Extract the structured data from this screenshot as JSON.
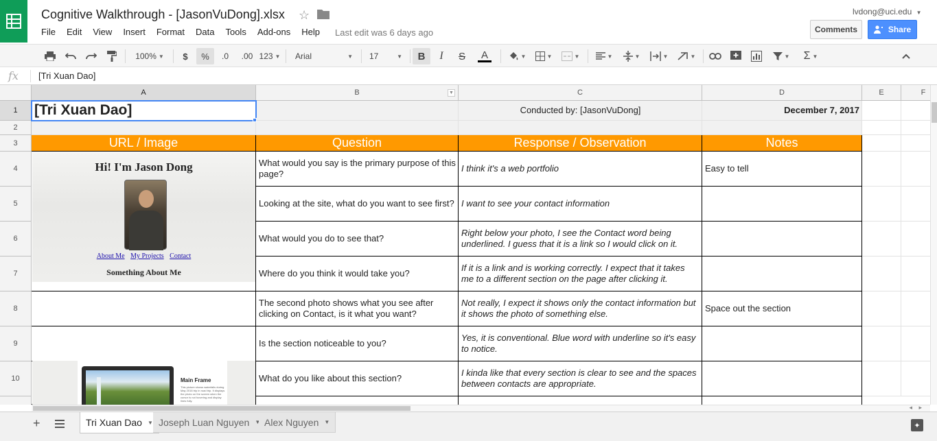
{
  "header": {
    "title": "Cognitive Walkthrough - [JasonVuDong].xlsx",
    "user_email": "lvdong@uci.edu",
    "last_edit": "Last edit was 6 days ago",
    "comments_label": "Comments",
    "share_label": "Share",
    "menu": [
      "File",
      "Edit",
      "View",
      "Insert",
      "Format",
      "Data",
      "Tools",
      "Add-ons",
      "Help"
    ]
  },
  "toolbar": {
    "zoom": "100%",
    "currency": "$",
    "percent": "%",
    "dec_less": ".0",
    "dec_more": ".00",
    "more_formats": "123",
    "font": "Arial",
    "font_size": "17",
    "bold": "B",
    "italic": "I",
    "strike": "S",
    "text_color": "A"
  },
  "formula": {
    "fx": "fx",
    "value": "[Tri Xuan Dao]"
  },
  "columns": [
    "A",
    "B",
    "C",
    "D",
    "E",
    "F"
  ],
  "rows": [
    "1",
    "2",
    "3",
    "4",
    "5",
    "6",
    "7",
    "8",
    "9",
    "10"
  ],
  "sheet": {
    "title_cell": "[Tri Xuan Dao]",
    "conducted_by": "Conducted by: [JasonVuDong]",
    "date": "December 7, 2017",
    "headers": [
      "URL / Image",
      "Question",
      "Response / Observation",
      "Notes"
    ],
    "rows": [
      {
        "q": "What would you say is the primary purpose of this page?",
        "r": "I think it's a web portfolio",
        "n": "Easy to tell"
      },
      {
        "q": "Looking at the site, what do you want to see first?",
        "r": "I want to see your contact information",
        "n": ""
      },
      {
        "q": "What would you do to see that?",
        "r": "Right below your photo, I see the Contact word being underlined. I guess that it is a link so I would click on it.",
        "n": ""
      },
      {
        "q": "Where do you think it would take you?",
        "r": "If it is a link and is working correctly. I expect that it takes me to a different section on the page after clicking it.",
        "n": ""
      },
      {
        "q": "The second photo shows what you see after clicking on Contact, is it what you want?",
        "r": "Not really, I expect it shows only the contact information but it shows the photo of something else.",
        "n": "Space out the section"
      },
      {
        "q": "Is the section noticeable to you?",
        "r": "Yes, it is conventional. Blue word with underline so it's easy to notice.",
        "n": ""
      },
      {
        "q": "What do you like about this section?",
        "r": "I kinda like that every section is clear to see and the spaces between contacts are appropriate.",
        "n": ""
      }
    ]
  },
  "image1": {
    "heading": "Hi! I'm Jason Dong",
    "links": [
      "About Me",
      "My Projects",
      "Contact"
    ],
    "subheading": "Something About Me"
  },
  "image2": {
    "heading": "Main Frame",
    "body": "This picture shows waterfalls during May 2016 trip in road trip. It displays the photo on the screen when the cursor is not hovering and display lines fully."
  },
  "tabs": [
    "Tri Xuan Dao",
    "Joseph Luan Nguyen",
    "Alex Nguyen"
  ],
  "colors": {
    "header_orange": "#ff9900",
    "brand_green": "#0f9d58",
    "share_blue": "#4d90fe",
    "selection_blue": "#4285f4"
  }
}
